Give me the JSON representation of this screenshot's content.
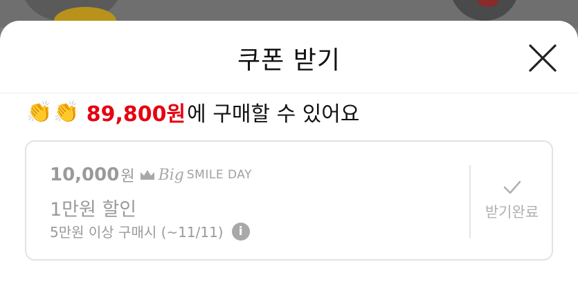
{
  "sheet": {
    "title": "쿠폰 받기"
  },
  "summary": {
    "clap_icons": [
      "clapping-hands-icon",
      "clapping-hands-icon"
    ],
    "price": "89,800원",
    "suffix": "에 구매할 수 있어요"
  },
  "coupon": {
    "amount": "10,000",
    "unit": "원",
    "brand_big": "Big",
    "brand_smile": "SMILE DAY",
    "name": "1만원 할인",
    "condition": "5만원 이상 구매시 (~11/11)",
    "info_glyph": "i",
    "action_label": "받기완료",
    "action_icon": "check-icon"
  },
  "colors": {
    "price_red": "#e60012",
    "disabled_gray": "#9a9a9a"
  }
}
